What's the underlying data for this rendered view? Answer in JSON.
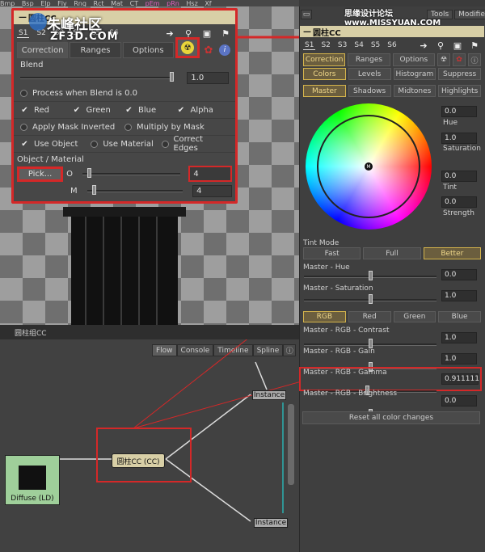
{
  "top_menu": [
    "Bmp",
    "Bsp",
    "Elp",
    "Fly",
    "Rng",
    "Rct",
    "Mat",
    "CT",
    "pEm",
    "pRn",
    "Hsz",
    "Xf"
  ],
  "watermark": {
    "logo": "朱峰社区",
    "sub": "ZF3D.COM",
    "right": "思缘设计论坛 www.MISSYUAN.COM"
  },
  "float_panel": {
    "title": "圆柱CC",
    "subtabs": [
      "S1",
      "S2",
      "S3",
      "S4",
      "S5",
      "S6"
    ],
    "tabs": [
      "Correction",
      "Ranges",
      "Options"
    ],
    "blend_label": "Blend",
    "blend_value": "1.0",
    "blend_level": 1.0,
    "process_label": "Process when Blend is 0.0",
    "channels": [
      "Red",
      "Green",
      "Blue",
      "Alpha"
    ],
    "mask_opts": [
      "Apply Mask Inverted",
      "Multiply by Mask"
    ],
    "object_opts": [
      "Use Object",
      "Use Material",
      "Correct Edges"
    ],
    "object_section": "Object / Material",
    "pick_label": "Pick...",
    "o_label": "O",
    "o_value": "4",
    "m_label": "M",
    "m_value": "4"
  },
  "viewer": {
    "caption": "圆柱组CC"
  },
  "node_view": {
    "tabs": [
      "Flow",
      "Console",
      "Timeline",
      "Spline"
    ],
    "nodes": {
      "cc": "圆柱CC (CC)",
      "diffuse": "Diffuse (LD)",
      "instance1": "Instance",
      "instance2": "Instance"
    }
  },
  "right_panel": {
    "title": "圆柱CC",
    "header_tabs": [
      "Tools",
      "Modifiers"
    ],
    "subtabs": [
      "S1",
      "S2",
      "S3",
      "S4",
      "S5",
      "S6"
    ],
    "tabs": [
      "Correction",
      "Ranges",
      "Options"
    ],
    "mode_buttons": [
      "Colors",
      "Levels",
      "Histogram",
      "Suppress"
    ],
    "range_buttons": [
      "Master",
      "Shadows",
      "Midtones",
      "Highlights"
    ],
    "wheel_marker": "M",
    "hue_value": "0.0",
    "hue_label": "Hue",
    "sat_value": "1.0",
    "sat_label": "Saturation",
    "tint_value": "0.0",
    "tint_label": "Tint",
    "strength_value": "0.0",
    "strength_label": "Strength",
    "tint_mode_label": "Tint Mode",
    "tint_modes": [
      "Fast",
      "Full",
      "Better"
    ],
    "master_hue_label": "Master - Hue",
    "master_hue_value": "0.0",
    "master_sat_label": "Master - Saturation",
    "master_sat_value": "1.0",
    "channel_buttons": [
      "RGB",
      "Red",
      "Green",
      "Blue"
    ],
    "contrast_label": "Master - RGB - Contrast",
    "contrast_value": "1.0",
    "gain_label": "Master - RGB - Gain",
    "gain_value": "1.0",
    "gamma_label": "Master - RGB - Gamma",
    "gamma_value": "0.911111",
    "brightness_label": "Master - RGB - Brightness",
    "brightness_value": "0.0",
    "reset_label": "Reset all color changes"
  },
  "colors": {
    "accent_red": "#d42828",
    "title_bar": "#d8cfa6",
    "active_gold": "#d4b44c"
  }
}
